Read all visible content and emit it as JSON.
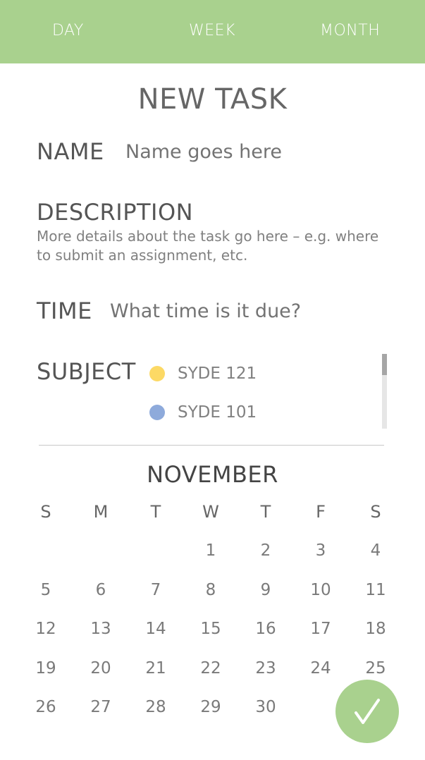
{
  "tabs": [
    "DAY",
    "WEEK",
    "MONTH"
  ],
  "title": "NEW TASK",
  "name": {
    "label": "NAME",
    "placeholder": "Name goes here"
  },
  "description": {
    "label": "DESCRIPTION",
    "placeholder": "More details about the task go here – e.g. where to submit an assignment, etc."
  },
  "time": {
    "label": "TIME",
    "placeholder": "What time is it due?"
  },
  "subject": {
    "label": "SUBJECT",
    "options": [
      {
        "label": "SYDE 121",
        "color": "#fcd965"
      },
      {
        "label": "SYDE 101",
        "color": "#8eaadb"
      }
    ]
  },
  "calendar": {
    "month": "NOVEMBER",
    "weekdays": [
      "S",
      "M",
      "T",
      "W",
      "T",
      "F",
      "S"
    ],
    "weeks": [
      [
        "",
        "",
        "",
        "1",
        "2",
        "3",
        "4"
      ],
      [
        "5",
        "6",
        "7",
        "8",
        "9",
        "10",
        "11"
      ],
      [
        "12",
        "13",
        "14",
        "15",
        "16",
        "17",
        "18"
      ],
      [
        "19",
        "20",
        "21",
        "22",
        "23",
        "24",
        "25"
      ],
      [
        "26",
        "27",
        "28",
        "29",
        "30",
        "",
        ""
      ]
    ]
  },
  "colors": {
    "accent": "#a9d18e"
  },
  "fab_icon": "checkmark-icon"
}
